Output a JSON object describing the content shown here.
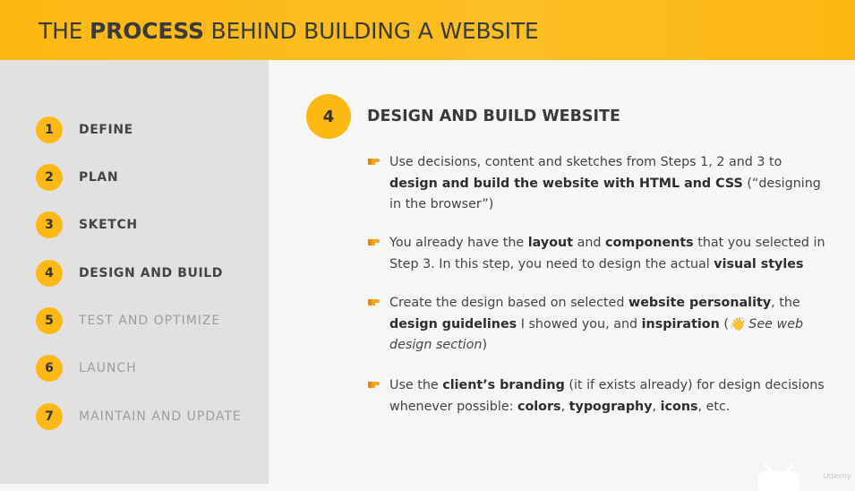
{
  "header": {
    "title_pre": "THE ",
    "title_bold": "PROCESS",
    "title_post": " BEHIND BUILDING A WEBSITE"
  },
  "sidebar": {
    "steps": [
      {
        "num": "1",
        "label": "DEFINE"
      },
      {
        "num": "2",
        "label": "PLAN"
      },
      {
        "num": "3",
        "label": "SKETCH"
      },
      {
        "num": "4",
        "label": "DESIGN AND BUILD"
      },
      {
        "num": "5",
        "label": "TEST AND OPTIMIZE"
      },
      {
        "num": "6",
        "label": "LAUNCH"
      },
      {
        "num": "7",
        "label": "MAINTAIN AND UPDATE"
      }
    ]
  },
  "main": {
    "step_num": "4",
    "title": "DESIGN AND BUILD WEBSITE",
    "bullets": [
      {
        "parts": [
          {
            "t": "Use decisions, content and sketches from Steps 1, 2 and 3 to "
          },
          {
            "t": "design and build the website with HTML and CSS",
            "b": true
          },
          {
            "t": " (“designing in the browser”)"
          }
        ]
      },
      {
        "parts": [
          {
            "t": "You already have the "
          },
          {
            "t": "layout",
            "b": true
          },
          {
            "t": " and "
          },
          {
            "t": "components",
            "b": true
          },
          {
            "t": " that you selected in Step 3. In this step, you need to design the actual "
          },
          {
            "t": "visual styles",
            "b": true
          }
        ]
      },
      {
        "parts": [
          {
            "t": "Create the design based on selected "
          },
          {
            "t": "website personality",
            "b": true
          },
          {
            "t": ", the "
          },
          {
            "t": "design guidelines",
            "b": true
          },
          {
            "t": " I showed you, and "
          },
          {
            "t": "inspiration",
            "b": true
          },
          {
            "t": " ("
          },
          {
            "t": "👋 See web design section",
            "i": true
          },
          {
            "t": ")"
          }
        ]
      },
      {
        "parts": [
          {
            "t": "Use the "
          },
          {
            "t": "client’s branding",
            "b": true
          },
          {
            "t": " (it if exists already) for design decisions whenever possible: "
          },
          {
            "t": "colors",
            "b": true
          },
          {
            "t": ", "
          },
          {
            "t": "typography",
            "b": true
          },
          {
            "t": ", "
          },
          {
            "t": "icons",
            "b": true
          },
          {
            "t": ", etc."
          }
        ]
      }
    ]
  },
  "watermark": "Udemy",
  "colors": {
    "accent": "#fdb813",
    "sidebar_bg": "#e1e1e1",
    "content_bg": "#f7f6f6",
    "text": "#444444",
    "dim_text": "#9c9c9c"
  },
  "icons": {
    "bullet": "pointing-hand-icon"
  }
}
